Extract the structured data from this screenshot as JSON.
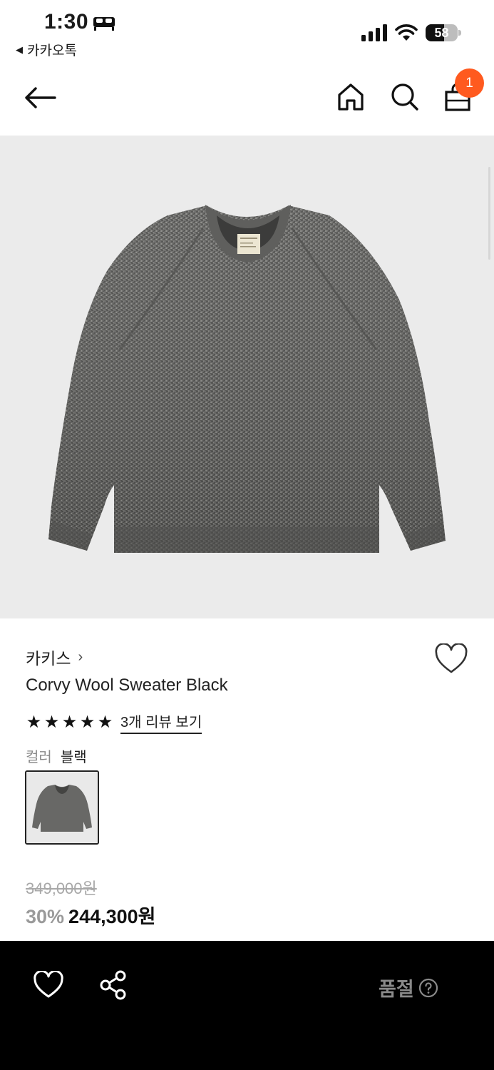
{
  "status_bar": {
    "time": "1:30",
    "back_app": "카카오톡",
    "battery": "58",
    "battery_level": 0.58,
    "icons": [
      "bed-icon",
      "signal-icon",
      "wifi-icon",
      "battery-icon"
    ]
  },
  "nav": {
    "icons": [
      "arrow-left-icon",
      "home-icon",
      "search-icon",
      "shopping-bag-icon"
    ],
    "cart_count": "1",
    "badge_color": "#ff5a1f"
  },
  "product": {
    "brand": "카키스",
    "brand_chevron": "›",
    "name": "Corvy Wool Sweater Black",
    "rating_stars": 5,
    "review_link": "3개 리뷰 보기",
    "color_label": "컬러",
    "color_value": "블랙",
    "original_price": "349,000원",
    "discount": "30%",
    "sale_price": "244,300원"
  },
  "bottom_bar": {
    "sold_out": "품절",
    "icons": [
      "heart-icon",
      "share-icon",
      "help-circle-icon"
    ],
    "background": "#000000"
  }
}
